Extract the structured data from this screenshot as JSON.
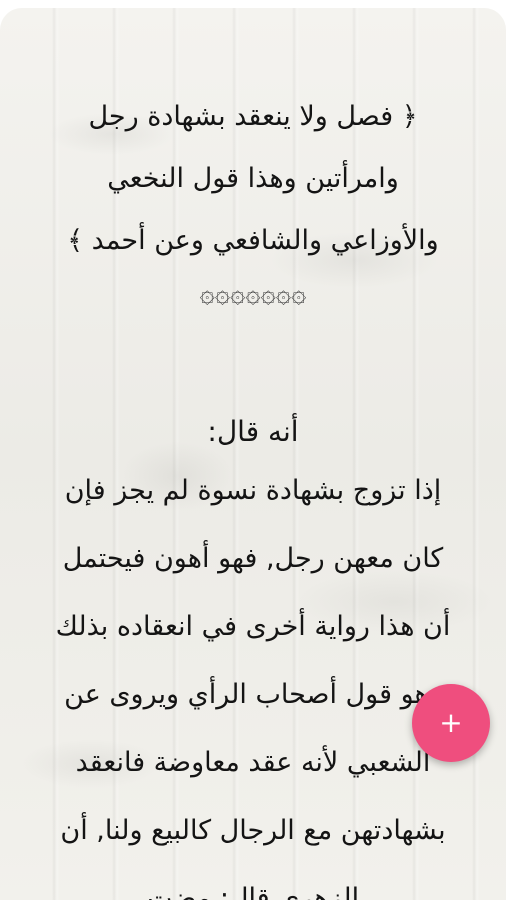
{
  "chapter": {
    "heading_lines": [
      "﴿ فصل ولا ينعقد بشهادة رجل",
      "وامرأتين وهذا قول النخعي",
      "والأوزاعي والشافعي وعن أحمد ﴾"
    ],
    "ornament": "۞۞۞۞۞۞۞"
  },
  "passage": {
    "title": "أنه قال:",
    "lines": [
      "إذا تزوج بشهادة نسوة لم يجز فإن",
      "كان معهن رجل, فهو أهون فيحتمل",
      "أن هذا رواية أخرى في انعقاده بذلك",
      "وهو قول أصحاب الرأي ويروى عن",
      "الشعبي لأنه عقد معاوضة فانعقد",
      "بشهادتهن مع الرجال كالبيع ولنا, أن",
      "الزهري قال: مضت"
    ]
  },
  "fab": {
    "icon": "plus-icon",
    "symbol": "+",
    "color": "#ef4e7e"
  }
}
